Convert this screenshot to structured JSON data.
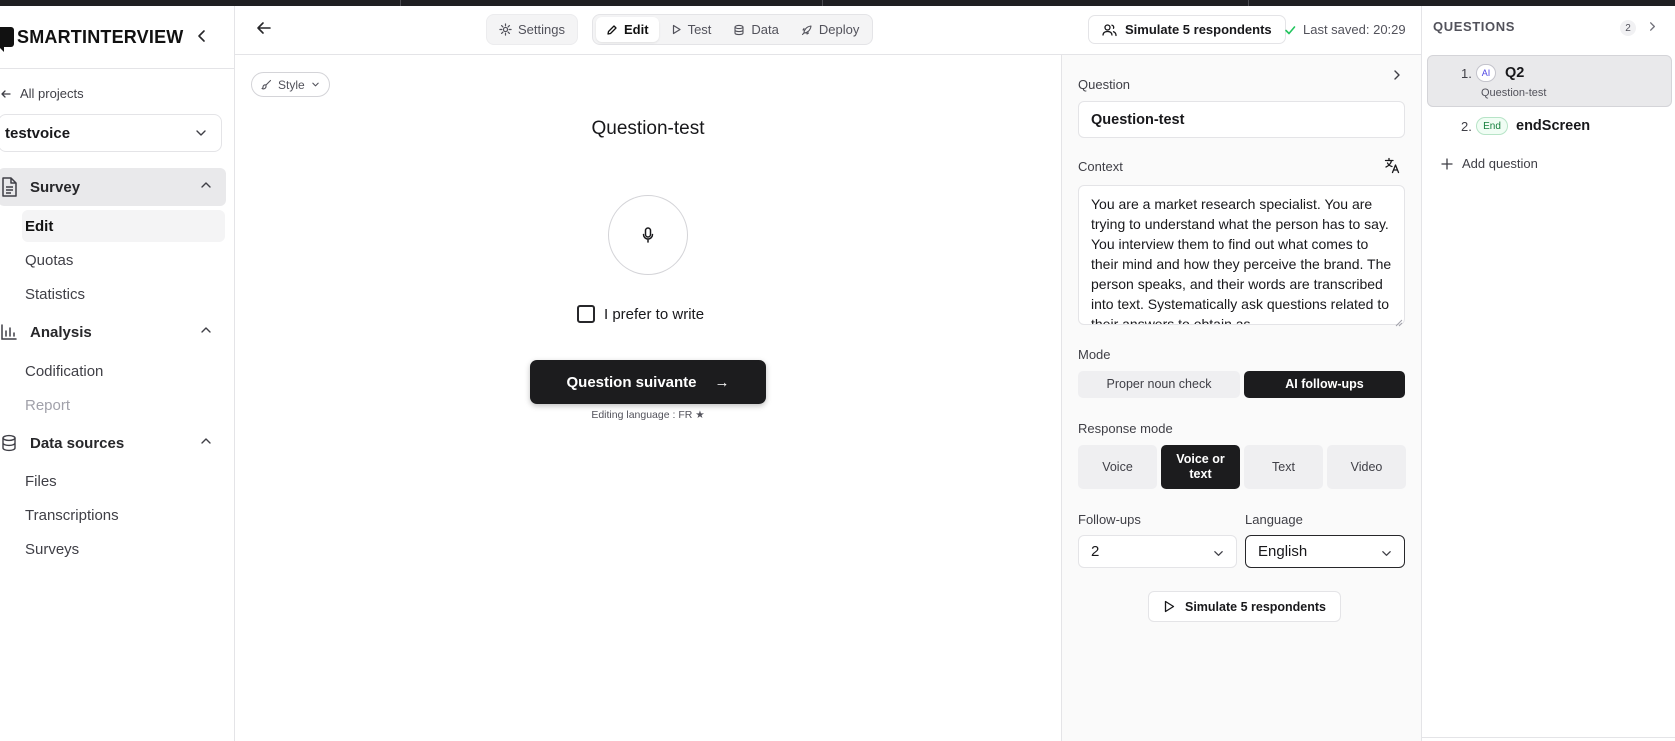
{
  "app": {
    "logo_text": "SMARTINTERVIEW",
    "all_projects_label": "All projects",
    "project_name": "testvoice"
  },
  "sidebar": {
    "groups": [
      {
        "label": "Survey",
        "icon": "document-icon",
        "expanded": true,
        "items": [
          {
            "label": "Edit",
            "active": true
          },
          {
            "label": "Quotas"
          },
          {
            "label": "Statistics"
          }
        ]
      },
      {
        "label": "Analysis",
        "icon": "bar-chart-icon",
        "expanded": true,
        "items": [
          {
            "label": "Codification"
          },
          {
            "label": "Report",
            "disabled": true
          }
        ]
      },
      {
        "label": "Data sources",
        "icon": "database-icon",
        "expanded": true,
        "items": [
          {
            "label": "Files"
          },
          {
            "label": "Transcriptions"
          },
          {
            "label": "Surveys"
          }
        ]
      }
    ]
  },
  "topbar": {
    "settings_label": "Settings",
    "tabs": [
      {
        "label": "Edit",
        "icon": "pencil-icon",
        "active": true
      },
      {
        "label": "Test",
        "icon": "play-icon"
      },
      {
        "label": "Data",
        "icon": "database-icon"
      },
      {
        "label": "Deploy",
        "icon": "rocket-icon"
      }
    ],
    "simulate_label": "Simulate 5 respondents",
    "saved_text": "Last saved: 20:29"
  },
  "preview": {
    "style_label": "Style",
    "question_title": "Question-test",
    "prefer_write_label": "I prefer to write",
    "next_button_label": "Question suivante",
    "next_button_arrow": "→",
    "editing_language": "Editing language : FR ★"
  },
  "config": {
    "question_label": "Question",
    "question_value": "Question-test",
    "context_label": "Context",
    "context_value": "You are a market research specialist. You are trying to understand what the person has to say. You interview them to find out what comes to their mind and how they perceive the brand. The person speaks, and their words are transcribed into text. Systematically ask questions related to their answers to obtain as",
    "mode_label": "Mode",
    "mode_options": [
      "Proper noun check",
      "AI follow-ups"
    ],
    "mode_selected": "AI follow-ups",
    "response_mode_label": "Response mode",
    "response_options": [
      "Voice",
      "Voice or text",
      "Text",
      "Video"
    ],
    "response_selected": "Voice or text",
    "followups_label": "Follow-ups",
    "followups_value": "2",
    "language_label": "Language",
    "language_value": "English",
    "simulate_label": "Simulate 5 respondents"
  },
  "questions_panel": {
    "title": "QUESTIONS",
    "count": "2",
    "items": [
      {
        "num": "1.",
        "badge": "AI",
        "name": "Q2",
        "subtitle": "Question-test",
        "active": true
      },
      {
        "num": "2.",
        "badge": "End",
        "name": "endScreen"
      }
    ],
    "add_label": "Add question"
  },
  "colors": {
    "accent_dark": "#1c1c1e",
    "active_nav_bg": "#e9e9eb",
    "saved_check": "#22c55e",
    "end_badge": "#15803d",
    "ai_badge": "#4f46e5"
  }
}
